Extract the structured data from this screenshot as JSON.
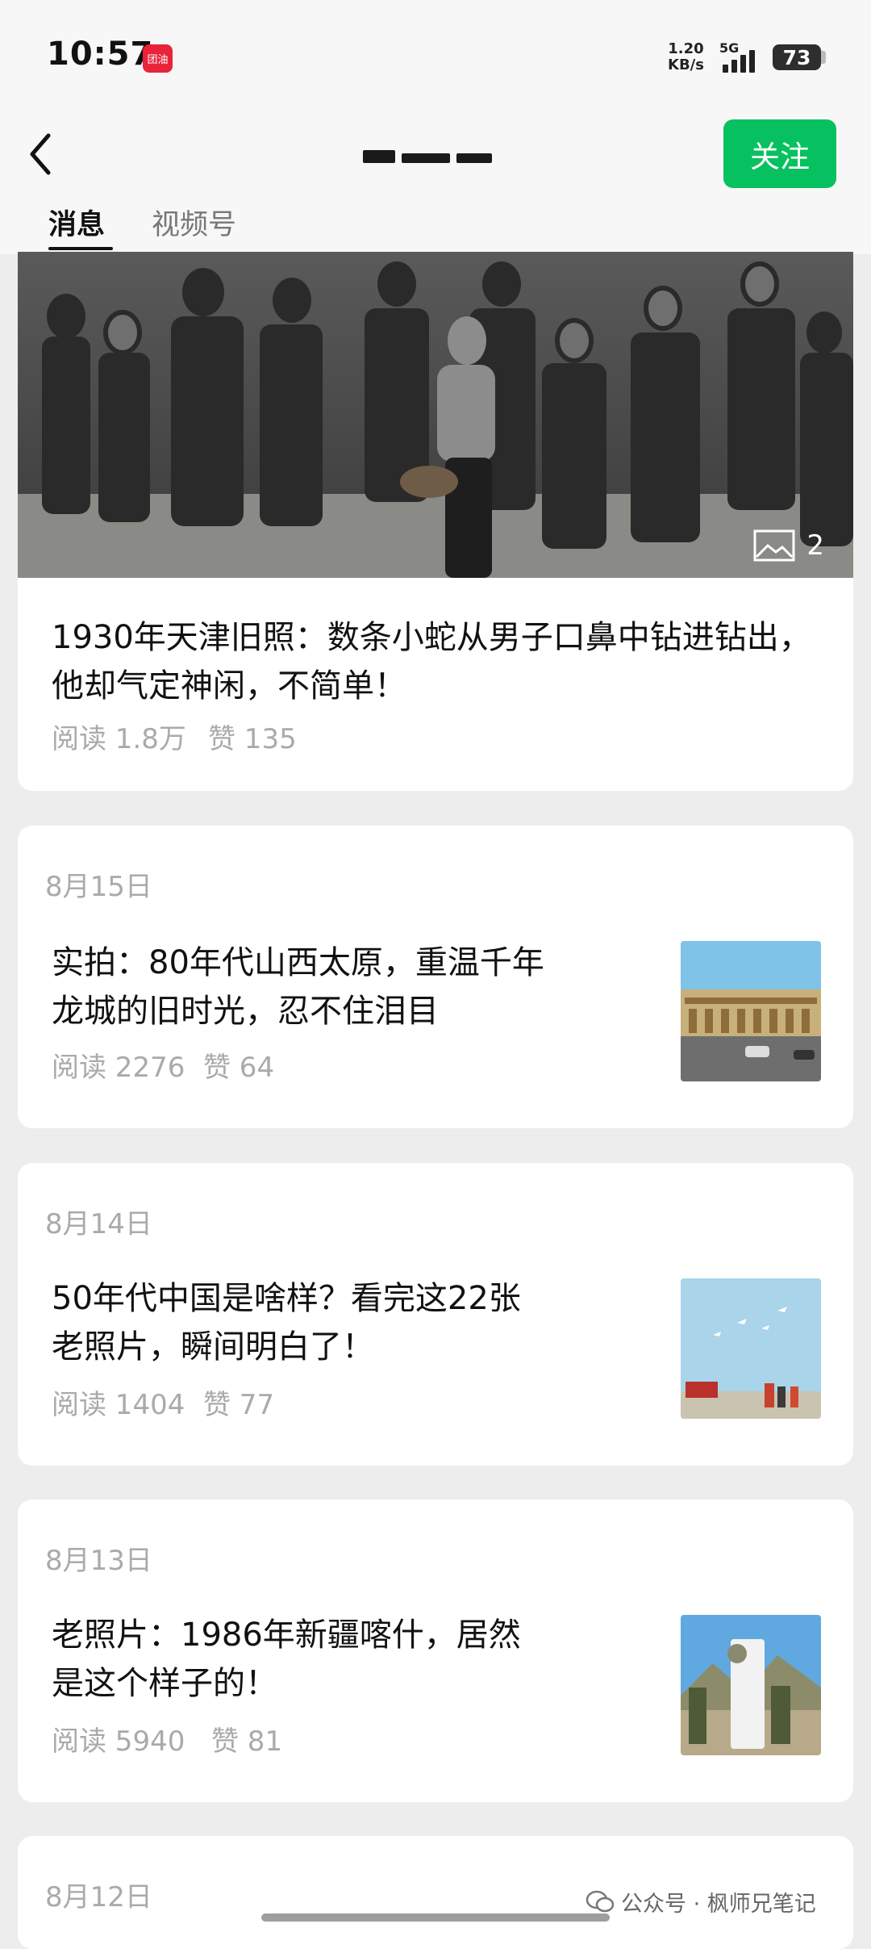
{
  "status_bar": {
    "time": "10:57",
    "app_badge": "团油",
    "net_speed_value": "1.20",
    "net_speed_unit": "KB/s",
    "network": "5G",
    "battery": "73"
  },
  "nav": {
    "follow_label": "关注"
  },
  "tabs": [
    {
      "label": "消息",
      "active": true
    },
    {
      "label": "视频号",
      "active": false
    }
  ],
  "hero": {
    "image_count": "2",
    "title": "1930年天津旧照：数条小蛇从男子口鼻中钻进钻出，他却气定神闲，不简单！",
    "reads": "阅读 1.8万",
    "likes": "赞 135"
  },
  "articles": [
    {
      "date": "8月15日",
      "title": "实拍：80年代山西太原，重温千年龙城的旧时光，忍不住泪目",
      "reads": "阅读 2276",
      "likes": "赞 64"
    },
    {
      "date": "8月14日",
      "title": "50年代中国是啥样？看完这22张老照片，瞬间明白了！",
      "reads": "阅读 1404",
      "likes": "赞 77"
    },
    {
      "date": "8月13日",
      "title": "老照片：1986年新疆喀什，居然是这个样子的！",
      "reads": "阅读 5940",
      "likes": "赞 81"
    },
    {
      "date": "8月12日"
    }
  ],
  "watermark": "公众号 · 枫师兄笔记",
  "colors": {
    "follow_button": "#07c160",
    "app_badge": "#e8233a",
    "background": "#ededed"
  }
}
